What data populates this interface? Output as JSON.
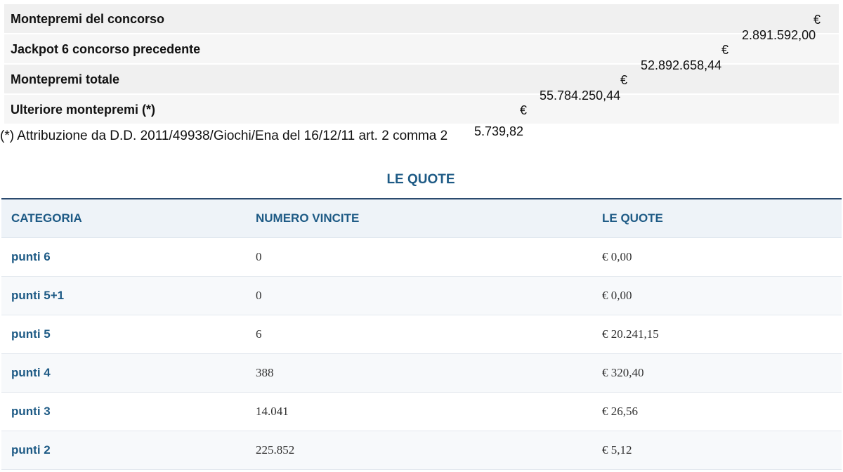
{
  "summary": {
    "rows": [
      {
        "label": "Montepremi del concorso",
        "currency": "€",
        "value": ""
      },
      {
        "label": "Jackpot 6 concorso precedente",
        "currency": "€",
        "value": "2.891.592,00"
      },
      {
        "label": "Montepremi totale",
        "currency": "€",
        "value": "52.892.658,44"
      },
      {
        "label": "Ulteriore montepremi (*)",
        "currency": "€",
        "value": "55.784.250,44"
      }
    ],
    "note": "(*) Attribuzione da D.D. 2011/49938/Giochi/Ena del 16/12/11 art. 2 comma 2",
    "note_value": "5.739,82"
  },
  "quote_section": {
    "title": "LE QUOTE",
    "headers": [
      "CATEGORIA",
      "NUMERO VINCITE",
      "LE QUOTE"
    ],
    "rows": [
      {
        "category": "punti 6",
        "wins": "0",
        "quota": "€ 0,00"
      },
      {
        "category": "punti 5+1",
        "wins": "0",
        "quota": "€ 0,00"
      },
      {
        "category": "punti 5",
        "wins": "6",
        "quota": "€ 20.241,15"
      },
      {
        "category": "punti 4",
        "wins": "388",
        "quota": "€ 320,40"
      },
      {
        "category": "punti 3",
        "wins": "14.041",
        "quota": "€ 26,56"
      },
      {
        "category": "punti 2",
        "wins": "225.852",
        "quota": "€ 5,12"
      }
    ]
  },
  "colors": {
    "accent": "#1d5a85",
    "header_border": "#2b4a6e",
    "row_bg": "#f0f0f0"
  }
}
